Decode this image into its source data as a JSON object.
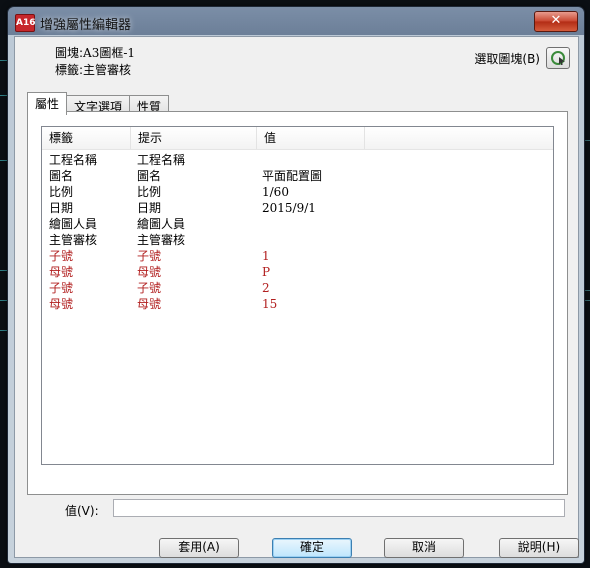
{
  "window": {
    "title": "增強屬性編輯器",
    "app_icon": "A16",
    "close_glyph": "✕"
  },
  "info": {
    "block_label": "圖塊:",
    "block_value": "A3圖框-1",
    "tag_label": "標籤:",
    "tag_value": "主管審核",
    "pick_label": "選取圖塊(B)"
  },
  "tabs": [
    "屬性",
    "文字選項",
    "性質"
  ],
  "grid": {
    "headers": [
      "標籤",
      "提示",
      "值"
    ],
    "rows": [
      {
        "tag": "工程名稱",
        "prompt": "工程名稱",
        "value": ""
      },
      {
        "tag": "圖名",
        "prompt": "圖名",
        "value": "平面配置圖"
      },
      {
        "tag": "比例",
        "prompt": "比例",
        "value": "1/60"
      },
      {
        "tag": "日期",
        "prompt": "日期",
        "value": "2015/9/1"
      },
      {
        "tag": "繪圖人員",
        "prompt": "繪圖人員",
        "value": ""
      },
      {
        "tag": "主管審核",
        "prompt": "主管審核",
        "value": ""
      },
      {
        "tag": "子號",
        "prompt": "子號",
        "value": "1"
      },
      {
        "tag": "母號",
        "prompt": "母號",
        "value": "P"
      },
      {
        "tag": "子號",
        "prompt": "子號",
        "value": "2"
      },
      {
        "tag": "母號",
        "prompt": "母號",
        "value": "15"
      }
    ],
    "highlight_color": "#b22020"
  },
  "value_field": {
    "label": "值(V):",
    "value": ""
  },
  "buttons": {
    "apply": "套用(A)",
    "ok": "確定",
    "cancel": "取消",
    "help": "說明(H)"
  }
}
